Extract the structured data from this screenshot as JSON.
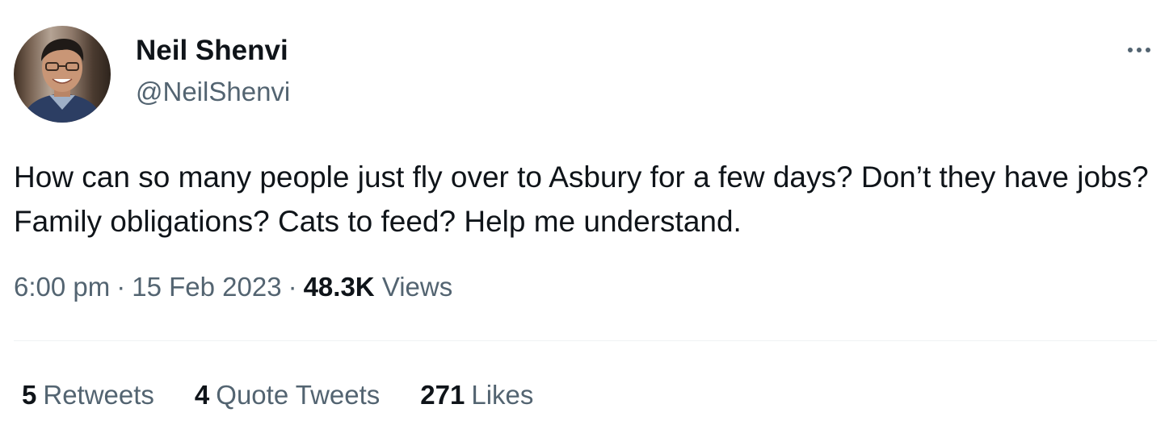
{
  "author": {
    "name": "Neil Shenvi",
    "handle": "@NeilShenvi",
    "avatar_icon": "profile-photo"
  },
  "more_icon": "more-options-icon",
  "tweet": {
    "text": "How can so many people just fly over to Asbury for a few days? Don’t they have jobs? Family obligations? Cats to feed? Help me understand."
  },
  "meta": {
    "time": "6:00 pm",
    "separator": "·",
    "date": "15 Feb 2023",
    "views_count": "48.3K",
    "views_label": "Views"
  },
  "stats": {
    "retweets_count": "5",
    "retweets_label": "Retweets",
    "quotes_count": "4",
    "quotes_label": "Quote Tweets",
    "likes_count": "271",
    "likes_label": "Likes"
  },
  "colors": {
    "text_primary": "#0f1419",
    "text_secondary": "#536471",
    "divider": "#eff3f4"
  }
}
